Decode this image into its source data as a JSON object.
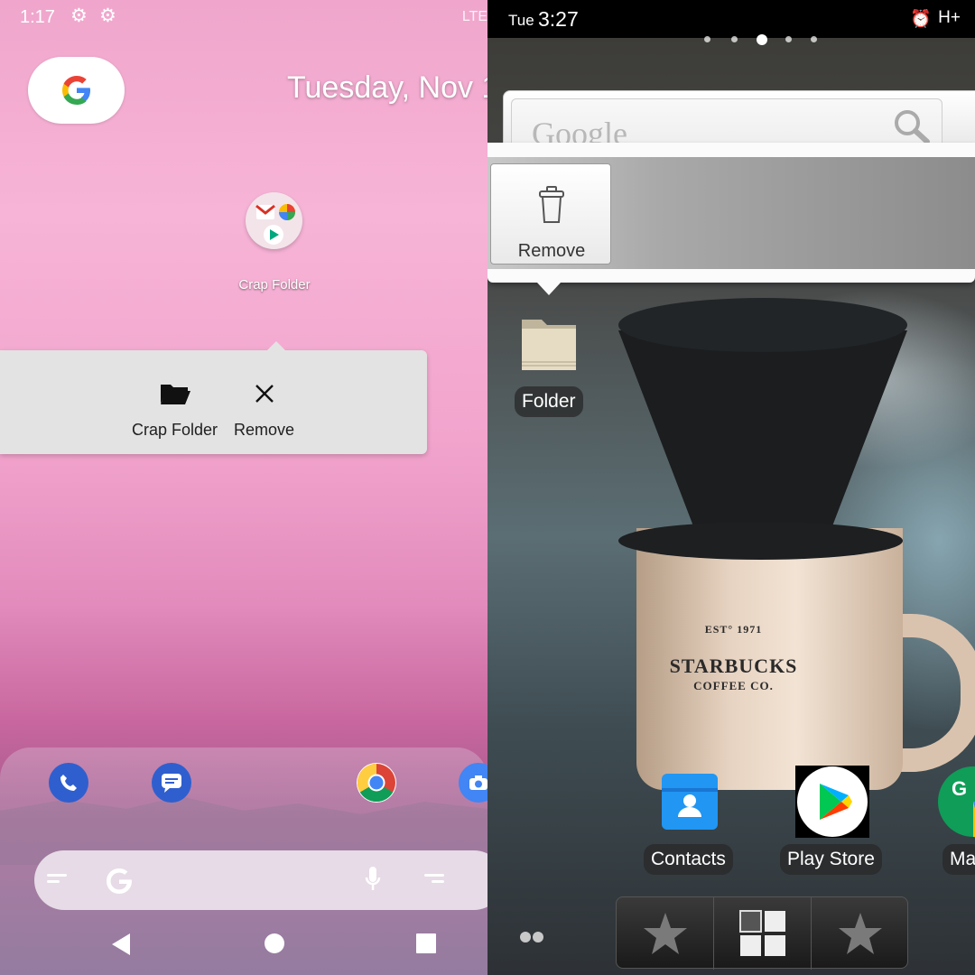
{
  "left": {
    "status": {
      "time": "1:17",
      "network": "LTE"
    },
    "date_widget": "Tuesday, Nov 1",
    "folder": {
      "label": "Crap Folder"
    },
    "popup": {
      "folder_option": "Crap Folder",
      "remove_option": "Remove"
    },
    "dock_apps": [
      "phone-icon",
      "messages-icon",
      "chrome-icon",
      "camera-icon"
    ],
    "colors": {
      "wallpaper_top": "#f7b4d6",
      "wallpaper_bottom": "#8a6e97",
      "popup_bg": "#e3e3e3"
    }
  },
  "right": {
    "status": {
      "day": "Tue",
      "time": "3:27",
      "network": "H+"
    },
    "search_widget": {
      "placeholder": "Google"
    },
    "remove_target": {
      "label": "Remove"
    },
    "desktop_folder": {
      "label": "Folder"
    },
    "mug": {
      "line1": "EST° 1971",
      "line2": "STARBUCKS",
      "line3": "COFFEE CO."
    },
    "apps": [
      {
        "label": "Contacts",
        "icon": "contacts-icon"
      },
      {
        "label": "Play Store",
        "icon": "play-store-icon"
      },
      {
        "label": "Ma",
        "icon": "maps-icon"
      }
    ],
    "dock": [
      "favorites-star-icon",
      "app-drawer-icon",
      "favorites-star-icon"
    ]
  }
}
